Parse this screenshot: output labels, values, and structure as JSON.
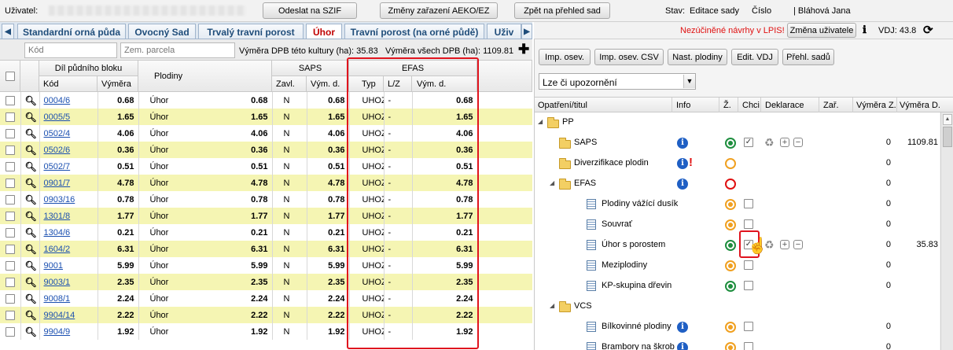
{
  "topbar": {
    "user_label": "Uživatel:",
    "send_button": "Odeslat na SZIF",
    "changes_button": "Změny zařazení AEKO/EZ",
    "back_button": "Zpět na přehled sad",
    "status_label": "Stav:",
    "status_value": "Editace sady",
    "number_label": "Číslo",
    "user_name": "| Bláhová Jana"
  },
  "tabs": [
    "Standardní orná půda",
    "Ovocný Sad",
    "Trvalý travní porost",
    "Úhor",
    "Travní porost (na orné půdě)",
    "Uživ"
  ],
  "active_tab": "Úhor",
  "filter": {
    "code_placeholder": "Kód",
    "parcel_placeholder": "Zem. parcela",
    "area_this_label": "Výměra DPB této kultury (ha):",
    "area_this_value": "35.83",
    "area_all_label": "Výměra všech DPB (ha):",
    "area_all_value": "1109.81"
  },
  "right_top": {
    "lpis_warning": "Nezúčiněné návrhy v LPIS!",
    "change_user_button": "Změna uživatele",
    "vdj_label": "VDJ: 43.8",
    "buttons": [
      "Imp. osev.",
      "Imp. osev. CSV",
      "Nast. plodiny",
      "Edit. VDJ",
      "Přehl. sadů"
    ],
    "select_value": "Lze či upozornění"
  },
  "table_headers": {
    "block": "Díl půdního bloku",
    "code": "Kód",
    "area": "Výměra",
    "crops": "Plodiny",
    "saps": "SAPS",
    "zavl": "Zavl.",
    "vym_d": "Vým. d.",
    "efas": "EFAS",
    "typ": "Typ",
    "lz": "L/Z",
    "efas_vym": "Vým. d."
  },
  "rows": [
    {
      "code": "0004/6",
      "area": "0.68",
      "crop": "Úhor",
      "crop_area": "0.68",
      "zavl": "N",
      "saps_vym": "0.68",
      "typ": "UHOZ",
      "lz": "-",
      "efas_vym": "0.68"
    },
    {
      "code": "0005/5",
      "area": "1.65",
      "crop": "Úhor",
      "crop_area": "1.65",
      "zavl": "N",
      "saps_vym": "1.65",
      "typ": "UHOZ",
      "lz": "-",
      "efas_vym": "1.65"
    },
    {
      "code": "0502/4",
      "area": "4.06",
      "crop": "Úhor",
      "crop_area": "4.06",
      "zavl": "N",
      "saps_vym": "4.06",
      "typ": "UHOZ",
      "lz": "-",
      "efas_vym": "4.06"
    },
    {
      "code": "0502/6",
      "area": "0.36",
      "crop": "Úhor",
      "crop_area": "0.36",
      "zavl": "N",
      "saps_vym": "0.36",
      "typ": "UHOZ",
      "lz": "-",
      "efas_vym": "0.36"
    },
    {
      "code": "0502/7",
      "area": "0.51",
      "crop": "Úhor",
      "crop_area": "0.51",
      "zavl": "N",
      "saps_vym": "0.51",
      "typ": "UHOZ",
      "lz": "-",
      "efas_vym": "0.51"
    },
    {
      "code": "0901/7",
      "area": "4.78",
      "crop": "Úhor",
      "crop_area": "4.78",
      "zavl": "N",
      "saps_vym": "4.78",
      "typ": "UHOZ",
      "lz": "-",
      "efas_vym": "4.78"
    },
    {
      "code": "0903/16",
      "area": "0.78",
      "crop": "Úhor",
      "crop_area": "0.78",
      "zavl": "N",
      "saps_vym": "0.78",
      "typ": "UHOZ",
      "lz": "-",
      "efas_vym": "0.78"
    },
    {
      "code": "1301/8",
      "area": "1.77",
      "crop": "Úhor",
      "crop_area": "1.77",
      "zavl": "N",
      "saps_vym": "1.77",
      "typ": "UHOZ",
      "lz": "-",
      "efas_vym": "1.77"
    },
    {
      "code": "1304/6",
      "area": "0.21",
      "crop": "Úhor",
      "crop_area": "0.21",
      "zavl": "N",
      "saps_vym": "0.21",
      "typ": "UHOZ",
      "lz": "-",
      "efas_vym": "0.21"
    },
    {
      "code": "1604/2",
      "area": "6.31",
      "crop": "Úhor",
      "crop_area": "6.31",
      "zavl": "N",
      "saps_vym": "6.31",
      "typ": "UHOZ",
      "lz": "-",
      "efas_vym": "6.31"
    },
    {
      "code": "9001",
      "area": "5.99",
      "crop": "Úhor",
      "crop_area": "5.99",
      "zavl": "N",
      "saps_vym": "5.99",
      "typ": "UHOZ",
      "lz": "-",
      "efas_vym": "5.99"
    },
    {
      "code": "9003/1",
      "area": "2.35",
      "crop": "Úhor",
      "crop_area": "2.35",
      "zavl": "N",
      "saps_vym": "2.35",
      "typ": "UHOZ",
      "lz": "-",
      "efas_vym": "2.35"
    },
    {
      "code": "9008/1",
      "area": "2.24",
      "crop": "Úhor",
      "crop_area": "2.24",
      "zavl": "N",
      "saps_vym": "2.24",
      "typ": "UHOZ",
      "lz": "-",
      "efas_vym": "2.24"
    },
    {
      "code": "9904/14",
      "area": "2.22",
      "crop": "Úhor",
      "crop_area": "2.22",
      "zavl": "N",
      "saps_vym": "2.22",
      "typ": "UHOZ",
      "lz": "-",
      "efas_vym": "2.22"
    },
    {
      "code": "9904/9",
      "area": "1.92",
      "crop": "Úhor",
      "crop_area": "1.92",
      "zavl": "N",
      "saps_vym": "1.92",
      "typ": "UHOZ",
      "lz": "-",
      "efas_vym": "1.92"
    }
  ],
  "tree_headers": {
    "title": "Opatření/titul",
    "info": "Info",
    "z": "Ž.",
    "chci": "Chci",
    "deklarace": "Deklarace",
    "zar": "Zař.",
    "vym_z": "Výměra Z.",
    "vym_d": "Výměra D."
  },
  "tree": [
    {
      "label": "PP",
      "kind": "folder",
      "level": 0,
      "expander": "◢",
      "info": false,
      "status": "",
      "chk": "",
      "actions": false,
      "vz": "",
      "vd": ""
    },
    {
      "label": "SAPS",
      "kind": "folder",
      "level": 1,
      "info": true,
      "status": "green-dot",
      "chk": "checked",
      "actions": true,
      "vz": "0",
      "vd": "1109.81"
    },
    {
      "label": "Diverzifikace plodin",
      "kind": "folder",
      "level": 1,
      "info": true,
      "warn": "!",
      "status": "orange",
      "chk": "",
      "actions": false,
      "vz": "0",
      "vd": ""
    },
    {
      "label": "EFAS",
      "kind": "folder",
      "level": 1,
      "expander": "◢",
      "info": true,
      "status": "red",
      "chk": "",
      "actions": false,
      "vz": "0",
      "vd": ""
    },
    {
      "label": "Plodiny vážící dusík",
      "kind": "doc",
      "level": 2,
      "info": false,
      "status": "orange-dot",
      "chk": "empty",
      "actions": false,
      "vz": "0",
      "vd": ""
    },
    {
      "label": "Souvrať",
      "kind": "doc",
      "level": 2,
      "info": false,
      "status": "orange-dot",
      "chk": "empty",
      "actions": false,
      "vz": "0",
      "vd": ""
    },
    {
      "label": "Úhor s porostem",
      "kind": "doc",
      "level": 2,
      "info": false,
      "status": "green-dot",
      "chk": "checked",
      "actions": true,
      "vz": "0",
      "vd": "35.83"
    },
    {
      "label": "Meziplodiny",
      "kind": "doc",
      "level": 2,
      "info": false,
      "status": "orange-dot",
      "chk": "empty",
      "actions": false,
      "vz": "0",
      "vd": ""
    },
    {
      "label": "KP-skupina dřevin",
      "kind": "doc",
      "level": 2,
      "info": false,
      "status": "green-dot",
      "chk": "empty",
      "actions": false,
      "vz": "0",
      "vd": ""
    },
    {
      "label": "VCS",
      "kind": "folder",
      "level": 1,
      "expander": "◢",
      "info": false,
      "status": "",
      "chk": "",
      "actions": false,
      "vz": "",
      "vd": ""
    },
    {
      "label": "Bílkovinné plodiny",
      "kind": "doc",
      "level": 2,
      "info": true,
      "status": "orange-dot",
      "chk": "empty",
      "actions": false,
      "vz": "0",
      "vd": ""
    },
    {
      "label": "Brambory na škrob",
      "kind": "doc",
      "level": 2,
      "info": true,
      "status": "orange-dot",
      "chk": "empty",
      "actions": false,
      "vz": "0",
      "vd": ""
    }
  ]
}
